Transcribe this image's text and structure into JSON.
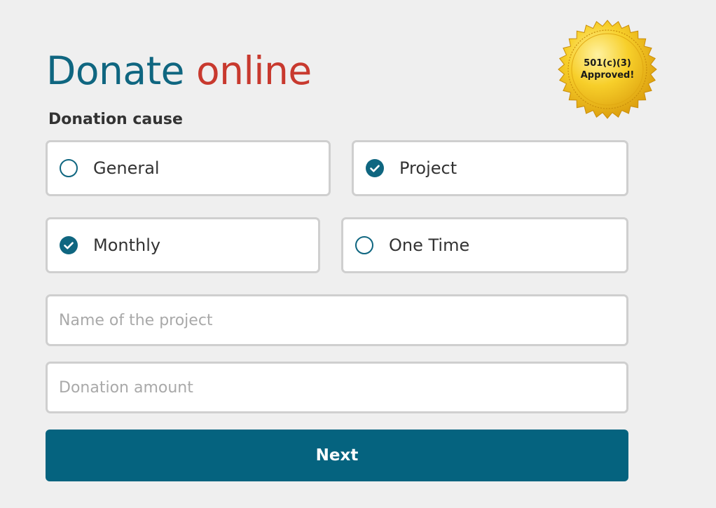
{
  "header": {
    "title_part1": "Donate",
    "title_part2": "online"
  },
  "seal": {
    "line1": "501(c)(3)",
    "line2": "Approved!"
  },
  "form": {
    "cause_label": "Donation cause",
    "options": [
      {
        "label": "General",
        "checked": false
      },
      {
        "label": "Project",
        "checked": true
      },
      {
        "label": "Monthly",
        "checked": true
      },
      {
        "label": "One Time",
        "checked": false
      }
    ],
    "project_name": {
      "value": "",
      "placeholder": "Name of the project"
    },
    "donation_amount": {
      "value": "",
      "placeholder": "Donation amount"
    },
    "next_label": "Next"
  },
  "colors": {
    "accent": "#0f6680",
    "title_red": "#c8392e",
    "button": "#05637f",
    "seal_gold": "#f2c21b",
    "background": "#efefef"
  },
  "icons": {
    "checked": "check-circle-icon",
    "unchecked": "radio-empty-icon"
  }
}
